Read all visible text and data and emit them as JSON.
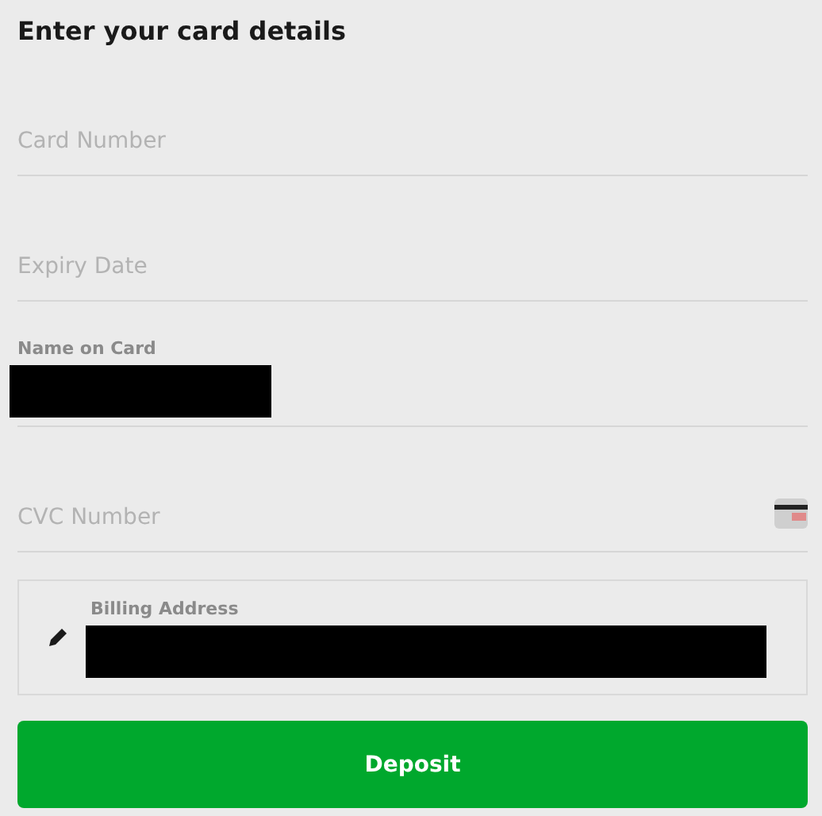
{
  "title": "Enter your card details",
  "fields": [
    {
      "kind": "empty",
      "placeholder": "Card Number"
    },
    {
      "kind": "empty",
      "placeholder": "Expiry Date"
    },
    {
      "kind": "filled",
      "label": "Name on Card",
      "value_redacted": true
    },
    {
      "kind": "empty",
      "placeholder": "CVC Number",
      "card_icon": true
    }
  ],
  "billing": {
    "label": "Billing Address",
    "value_redacted": true
  },
  "button": "Deposit"
}
